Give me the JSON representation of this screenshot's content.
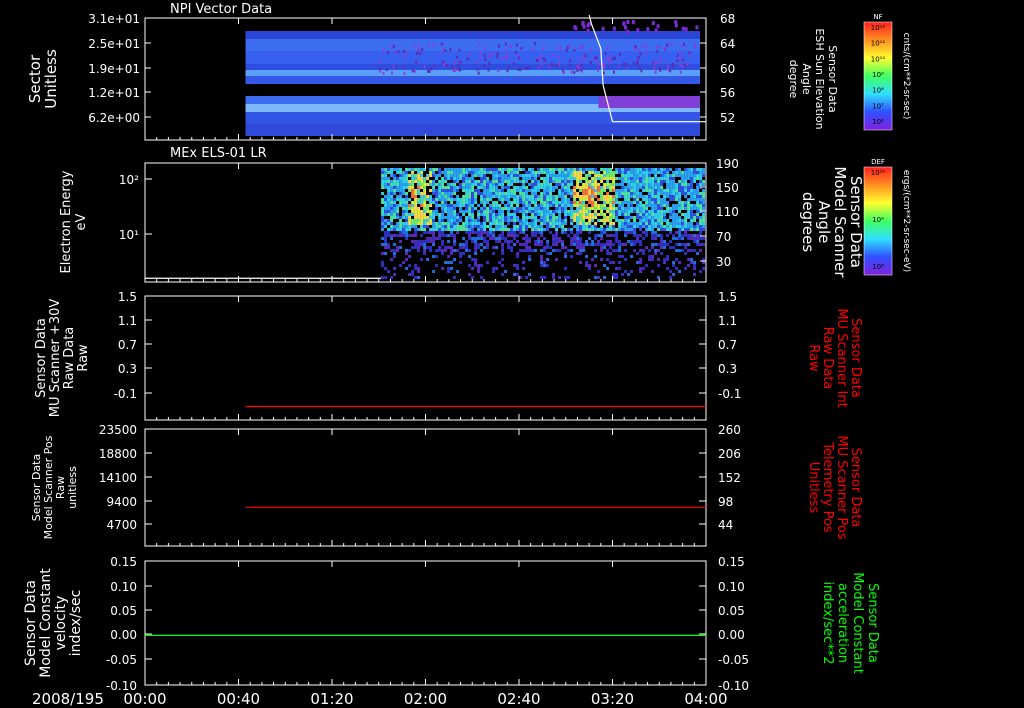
{
  "time_axis": {
    "date_label": "2008/195",
    "ticks": [
      "00:00",
      "00:40",
      "01:20",
      "02:00",
      "02:40",
      "03:20",
      "04:00"
    ],
    "range_minutes": [
      0,
      240
    ]
  },
  "panels": [
    {
      "id": "npi",
      "title": "NPI Vector Data",
      "left_label": [
        "Sector",
        "Unitless"
      ],
      "left_ticks": [
        "3.1e+01",
        "2.5e+01",
        "1.9e+01",
        "1.2e+01",
        "6.2e+00"
      ],
      "right_ticks": [
        "68",
        "64",
        "60",
        "56",
        "52"
      ],
      "right_label": [
        "Sensor Data",
        "ESH Sun Elevation",
        "Angle",
        "degree"
      ],
      "right_label_color": "#ffffff"
    },
    {
      "id": "els",
      "title": "MEx ELS-01 LR",
      "left_label": [
        "Electron Energy",
        "eV"
      ],
      "left_ticks": [
        "10²",
        "10¹"
      ],
      "right_ticks": [
        "190",
        "150",
        "110",
        "70",
        "30"
      ],
      "right_label": [
        "Sensor Data",
        "Model Scanner",
        "Angle",
        "degrees"
      ],
      "right_label_color": "#ffffff"
    },
    {
      "id": "mu_raw",
      "title": "",
      "left_label": [
        "Sensor Data",
        "MU Scanner +30V",
        "Raw Data",
        "Raw"
      ],
      "left_ticks": [
        "1.5",
        "1.1",
        "0.7",
        "0.3",
        "-0.1"
      ],
      "right_ticks": [
        "1.5",
        "1.1",
        "0.7",
        "0.3",
        "-0.1"
      ],
      "right_label": [
        "Sensor Data",
        "MU Scanner Int",
        "Raw Data",
        "Raw"
      ],
      "right_label_color": "#ff0000"
    },
    {
      "id": "mu_pos",
      "title": "",
      "left_label": [
        "Sensor Data",
        "Model Scanner Pos",
        "Raw",
        "unitless"
      ],
      "left_ticks": [
        "23500",
        "18800",
        "14100",
        "9400",
        "4700"
      ],
      "right_ticks": [
        "260",
        "206",
        "152",
        "98",
        "44"
      ],
      "right_label": [
        "Sensor Data",
        "MU Scanner Pos",
        "Telemetry Pos",
        "Unitless"
      ],
      "right_label_color": "#ff0000"
    },
    {
      "id": "model",
      "title": "",
      "left_label": [
        "Sensor Data",
        "Model Constant",
        "velocity",
        "index/sec"
      ],
      "left_ticks": [
        "0.15",
        "0.10",
        "0.05",
        "0.00",
        "-0.05",
        "-0.10"
      ],
      "right_ticks": [
        "0.15",
        "0.10",
        "0.05",
        "0.00",
        "-0.05",
        "-0.10"
      ],
      "right_label": [
        "Sensor Data",
        "Model Constant",
        "acceleration",
        "index/sec**2"
      ],
      "right_label_color": "#00ff00"
    }
  ],
  "colorbars": [
    {
      "id": "nf",
      "label": "NF",
      "ticks": [
        "10¹²",
        "10¹¹",
        "10¹⁰",
        "10⁹",
        "10⁸",
        "10⁷",
        "10⁶"
      ],
      "units": "cnts/(cm**2-sr-sec)"
    },
    {
      "id": "def",
      "label": "DEF",
      "ticks": [
        "10¹⁰",
        "10⁹",
        "10⁸"
      ],
      "units": "ergs/(cm**2-sr-sec-eV)"
    }
  ],
  "colors": {
    "red_line": "#ff0000",
    "green_line": "#00ff00",
    "white_line": "#ffffff"
  },
  "chart_data": [
    {
      "type": "heatmap",
      "panel": "npi",
      "title": "NPI Vector Data",
      "ylabel": "Sector Unitless",
      "y_ticks": [
        "3.1e+01",
        "2.5e+01",
        "1.9e+01",
        "1.2e+01",
        "6.2e+00"
      ],
      "data_start_minutes": 43,
      "overlay_line": {
        "name": "ESH Sun Elevation Angle",
        "units": "degree",
        "x_minutes": [
          0,
          190,
          191,
          195,
          196,
          200,
          220,
          240
        ],
        "y": [
          68.5,
          68.5,
          67,
          63,
          57,
          51,
          51,
          51
        ],
        "ylim": [
          48,
          68
        ],
        "visible_from_minutes": 189
      }
    },
    {
      "type": "heatmap",
      "panel": "els",
      "title": "MEx ELS-01 LR",
      "ylabel": "Electron Energy eV",
      "yscale": "log",
      "data_start_minutes": 101,
      "intense_intervals_minutes": [
        [
          112,
          122
        ],
        [
          182,
          200
        ]
      ],
      "overlay_line": {
        "name": "Model Scanner Angle",
        "units": "degrees",
        "x_minutes": [
          0,
          101
        ],
        "y": [
          6,
          6
        ],
        "ylim": [
          0,
          190
        ]
      }
    },
    {
      "type": "line",
      "panel": "mu_raw",
      "series": [
        {
          "x_minutes": [
            43,
            240
          ],
          "y": [
            -0.06,
            -0.06
          ]
        }
      ],
      "ylim": [
        -0.25,
        1.5
      ]
    },
    {
      "type": "line",
      "panel": "mu_pos",
      "series": [
        {
          "x_minutes": [
            43,
            240
          ],
          "y": [
            7770,
            7770
          ]
        }
      ],
      "ylim": [
        0,
        23500
      ]
    },
    {
      "type": "line",
      "panel": "model",
      "series": [
        {
          "x_minutes": [
            0,
            240
          ],
          "y": [
            0.0,
            0.0
          ]
        }
      ],
      "ylim": [
        -0.1,
        0.15
      ]
    }
  ]
}
